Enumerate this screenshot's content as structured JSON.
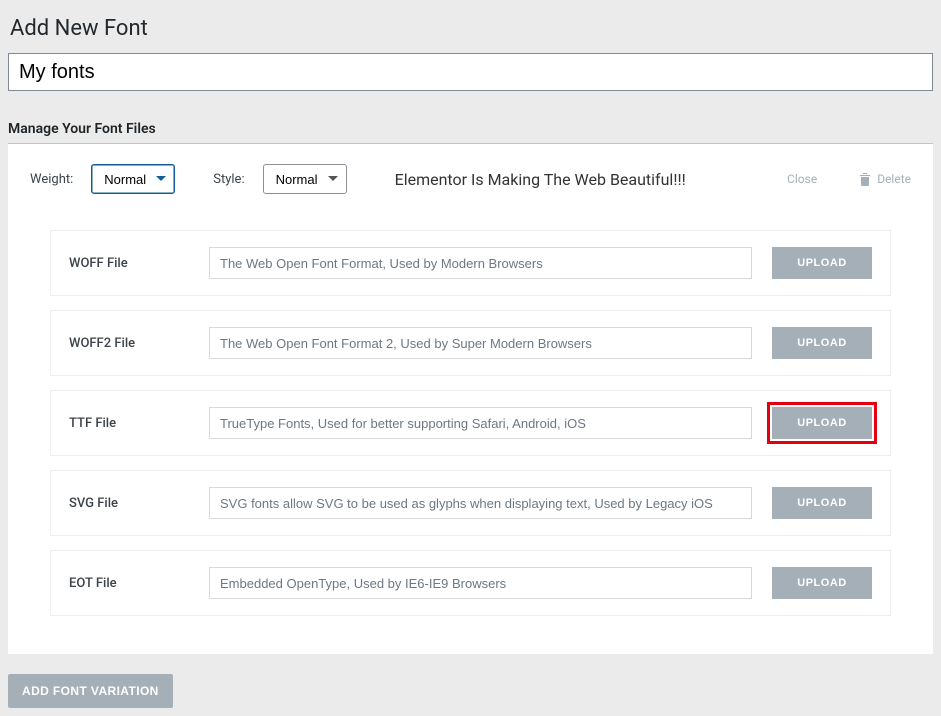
{
  "page": {
    "title": "Add New Font",
    "font_name_value": "My fonts",
    "section_title": "Manage Your Font Files"
  },
  "variation": {
    "weight_label": "Weight:",
    "weight_value": "Normal",
    "style_label": "Style:",
    "style_value": "Normal",
    "preview_text": "Elementor Is Making The Web Beautiful!!!",
    "close_label": "Close",
    "delete_label": "Delete"
  },
  "files": [
    {
      "label": "WOFF File",
      "placeholder": "The Web Open Font Format, Used by Modern Browsers",
      "highlighted": false
    },
    {
      "label": "WOFF2 File",
      "placeholder": "The Web Open Font Format 2, Used by Super Modern Browsers",
      "highlighted": false
    },
    {
      "label": "TTF File",
      "placeholder": "TrueType Fonts, Used for better supporting Safari, Android, iOS",
      "highlighted": true
    },
    {
      "label": "SVG File",
      "placeholder": "SVG fonts allow SVG to be used as glyphs when displaying text, Used by Legacy iOS",
      "highlighted": false
    },
    {
      "label": "EOT File",
      "placeholder": "Embedded OpenType, Used by IE6-IE9 Browsers",
      "highlighted": false
    }
  ],
  "buttons": {
    "upload": "UPLOAD",
    "add_variation": "ADD FONT VARIATION"
  }
}
